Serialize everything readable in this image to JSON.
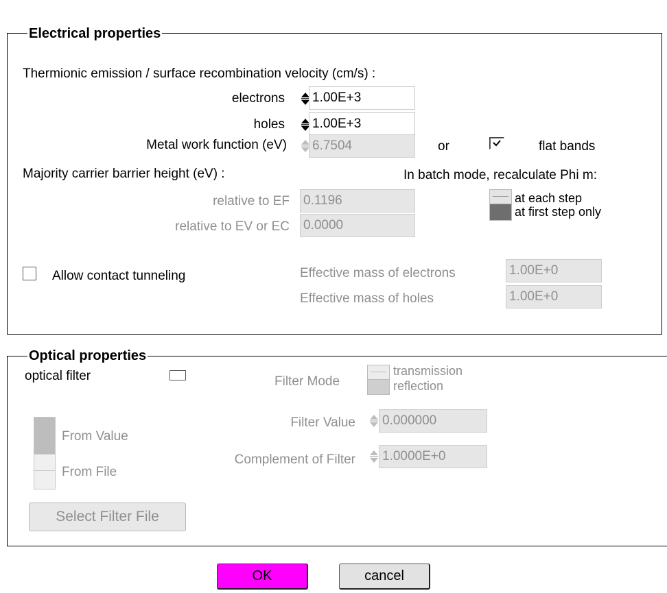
{
  "electrical": {
    "legend": "Electrical properties",
    "thermionic_label": "Thermionic emission / surface recombination velocity (cm/s) :",
    "electrons_label": "electrons",
    "electrons_value": "1.00E+3",
    "holes_label": "holes",
    "holes_value": "1.00E+3",
    "work_function_label": "Metal work function (eV)",
    "work_function_value": "6.7504",
    "or_label": "or",
    "flat_bands_label": "flat bands",
    "flat_bands_checked": true,
    "barrier_label": "Majority carrier barrier height (eV) :",
    "batch_label": "In batch mode, recalculate Phi  m:",
    "relative_ef_label": "relative to EF",
    "relative_ef_value": "0.1196",
    "relative_ev_label": "relative to EV or EC",
    "relative_ev_value": "0.0000",
    "batch_options": [
      "at each step",
      "at first step only"
    ],
    "batch_selected": "at first step only",
    "tunneling_label": "Allow contact tunneling",
    "tunneling_checked": false,
    "eff_mass_electrons_label": "Effective mass of electrons",
    "eff_mass_electrons_value": "1.00E+0",
    "eff_mass_holes_label": "Effective mass of holes",
    "eff_mass_holes_value": "1.00E+0"
  },
  "optical": {
    "legend": "Optical properties",
    "filter_label": "optical filter",
    "filter_checked": false,
    "filter_mode_label": "Filter Mode",
    "filter_mode_options": [
      "transmission",
      "reflection"
    ],
    "source_options": [
      "From Value",
      "From File"
    ],
    "filter_value_label": "Filter Value",
    "filter_value": "0.000000",
    "complement_label": "Complement of Filter",
    "complement_value": "1.0000E+0",
    "select_file_label": "Select Filter File"
  },
  "buttons": {
    "ok_label": "OK",
    "cancel_label": "cancel",
    "ok_color": "#ff00ff"
  }
}
